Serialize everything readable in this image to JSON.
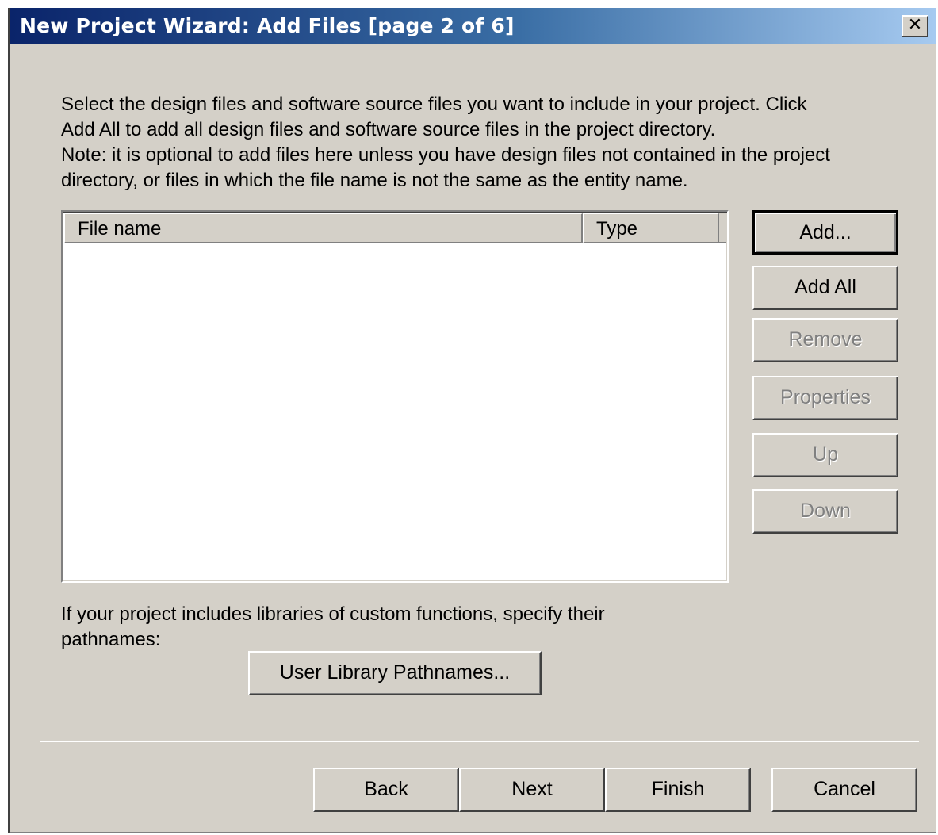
{
  "window": {
    "title": "New Project Wizard: Add Files [page 2 of 6]",
    "close_glyph": "✕"
  },
  "description": {
    "lines": [
      "Select the design files and software source files you want to include in your project.  Click",
      "Add All to add all design files and software source files in the project directory.",
      "Note: it is optional to add files here unless you have design files not contained in the project",
      "directory, or files in which the file name is not the same as the entity name."
    ]
  },
  "file_list": {
    "columns": [
      "File name",
      "Type"
    ],
    "rows": []
  },
  "side_buttons": {
    "add": "Add...",
    "add_all": "Add All",
    "remove": "Remove",
    "properties": "Properties",
    "up": "Up",
    "down": "Down"
  },
  "library": {
    "text_line1": "If your project includes libraries of custom functions, specify their",
    "text_line2": "pathnames:",
    "button": "User Library Pathnames..."
  },
  "footer_buttons": {
    "back": "Back",
    "next": "Next",
    "finish": "Finish",
    "cancel": "Cancel"
  }
}
